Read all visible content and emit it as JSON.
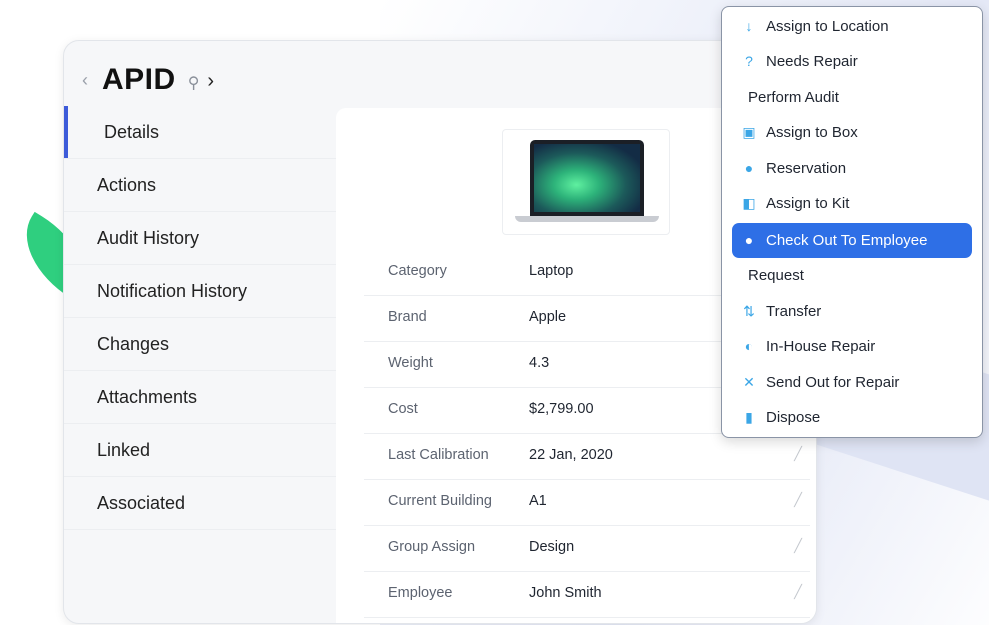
{
  "header": {
    "title": "APID",
    "prev_icon": "‹",
    "search_icon": "⚲",
    "next_icon": "›"
  },
  "sidebar": {
    "items": [
      {
        "label": "Details",
        "active": true
      },
      {
        "label": "Actions"
      },
      {
        "label": "Audit History"
      },
      {
        "label": "Notification History"
      },
      {
        "label": "Changes"
      },
      {
        "label": "Attachments"
      },
      {
        "label": "Linked"
      },
      {
        "label": "Associated"
      }
    ]
  },
  "details": {
    "rows": [
      {
        "label": "Category",
        "value": "Laptop"
      },
      {
        "label": "Brand",
        "value": "Apple"
      },
      {
        "label": "Weight",
        "value": "4.3"
      },
      {
        "label": "Cost",
        "value": "$2,799.00"
      },
      {
        "label": "Last Calibration",
        "value": "22 Jan, 2020"
      },
      {
        "label": "Current Building",
        "value": "A1"
      },
      {
        "label": "Group Assign",
        "value": "Design"
      },
      {
        "label": "Employee",
        "value": "John Smith"
      }
    ]
  },
  "menu": {
    "items": [
      {
        "label": "Assign to Location",
        "icon": "location-pin-icon",
        "glyph": "↓"
      },
      {
        "label": "Needs Repair",
        "icon": "question-icon",
        "glyph": "?"
      },
      {
        "label": "Perform Audit",
        "icon": "",
        "glyph": ""
      },
      {
        "label": "Assign to Box",
        "icon": "box-icon",
        "glyph": "▣"
      },
      {
        "label": "Reservation",
        "icon": "person-icon",
        "glyph": "●"
      },
      {
        "label": "Assign to Kit",
        "icon": "kit-icon",
        "glyph": "◧"
      },
      {
        "label": "Check Out To Employee",
        "icon": "person-icon",
        "glyph": "●",
        "highlighted": true
      },
      {
        "label": "Request",
        "icon": "",
        "glyph": ""
      },
      {
        "label": "Transfer",
        "icon": "transfer-icon",
        "glyph": "⇅"
      },
      {
        "label": "In-House Repair",
        "icon": "shield-icon",
        "glyph": "◐"
      },
      {
        "label": "Send Out for Repair",
        "icon": "tools-icon",
        "glyph": "✕"
      },
      {
        "label": "Dispose",
        "icon": "trash-icon",
        "glyph": "▮"
      }
    ]
  },
  "colors": {
    "accent": "#3d5bd9",
    "menu_highlight": "#2e6fe6",
    "leaf": "#2fcf7f",
    "menu_icon": "#3ba6e6"
  }
}
